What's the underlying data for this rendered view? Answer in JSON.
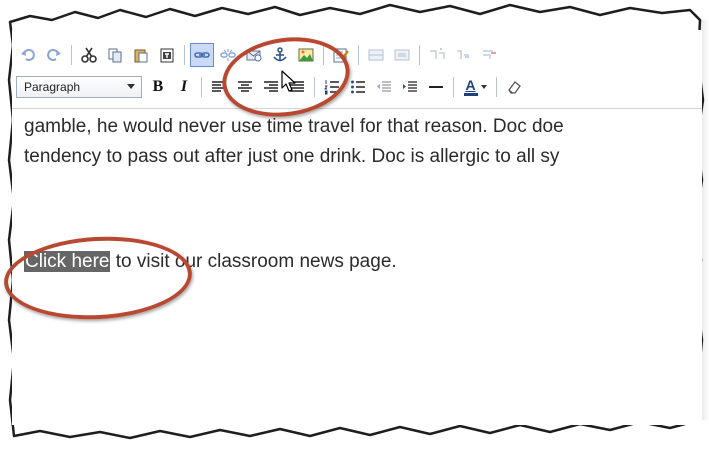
{
  "toolbar": {
    "row1": [
      {
        "name": "undo-icon"
      },
      {
        "name": "redo-icon"
      },
      {
        "name": "cut-icon"
      },
      {
        "name": "copy-icon"
      },
      {
        "name": "paste-icon"
      },
      {
        "name": "paste-text-icon"
      },
      {
        "name": "insert-link-icon",
        "active": true
      },
      {
        "name": "unlink-icon"
      },
      {
        "name": "email-link-icon"
      },
      {
        "name": "anchor-icon"
      },
      {
        "name": "insert-image-icon"
      },
      {
        "name": "edit-html-icon"
      },
      {
        "name": "insert-row-icon"
      },
      {
        "name": "delete-row-icon"
      },
      {
        "name": "table-icon"
      }
    ],
    "format_select": {
      "value": "Paragraph"
    },
    "bold_label": "B",
    "italic_label": "I",
    "font_color_label": "A"
  },
  "content": {
    "line1": "gamble, he would never use time travel for that reason. Doc doe",
    "line2": "tendency to pass out after just one drink. Doc is allergic to all sy",
    "link_selected_text": "Click here",
    "link_rest_text": " to visit our classroom news page."
  },
  "colors": {
    "annotation": "#b84830",
    "selection_bg": "#666666",
    "active_button_bg": "#c9daf6"
  }
}
